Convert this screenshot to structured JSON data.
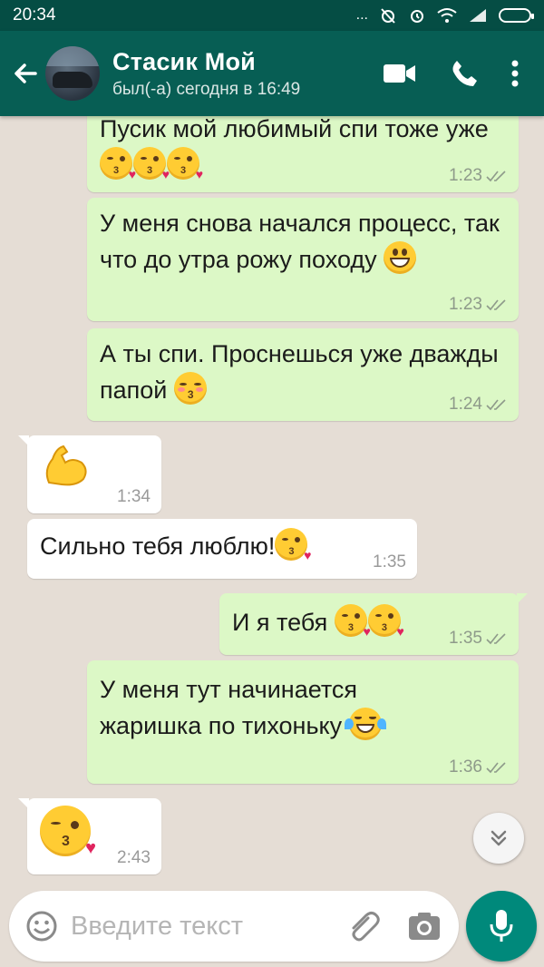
{
  "status_bar": {
    "time": "20:34",
    "icons": [
      "more-dots-icon",
      "alarm-off-icon",
      "alarm-icon",
      "wifi-icon",
      "signal-icon",
      "battery-icon"
    ],
    "dots": "..."
  },
  "header": {
    "contact_name": "Стасик Мой",
    "last_seen": "был(-а) сегодня в 16:49",
    "actions": [
      "video-call-icon",
      "phone-icon",
      "more-vert-icon"
    ],
    "color": "#075e54"
  },
  "messages": [
    {
      "dir": "out",
      "text": "Пусик мой любимый спи тоже уже",
      "time": "1:23",
      "read": true
    },
    {
      "dir": "out",
      "text": "У меня снова начался процесс, так что до утра рожу походу",
      "time": "1:23",
      "read": true
    },
    {
      "dir": "out",
      "text": "А ты спи. Проснешься уже дважды папой",
      "time": "1:24",
      "read": true
    },
    {
      "dir": "in",
      "text": "",
      "time": "1:34"
    },
    {
      "dir": "in",
      "text": "Сильно тебя люблю!",
      "time": "1:35"
    },
    {
      "dir": "out",
      "text": "И я тебя",
      "time": "1:35",
      "read": true
    },
    {
      "dir": "out",
      "text": "У меня тут начинается жаришка по тихоньку",
      "time": "1:36",
      "read": true
    },
    {
      "dir": "in",
      "text": "",
      "time": "2:43"
    }
  ],
  "composer": {
    "placeholder": "Введите текст"
  },
  "colors": {
    "outgoing": "#dcf8c6",
    "incoming": "#ffffff",
    "background": "#e5ddd5",
    "accent": "#00897b",
    "ticks": "#8e9a8a"
  }
}
